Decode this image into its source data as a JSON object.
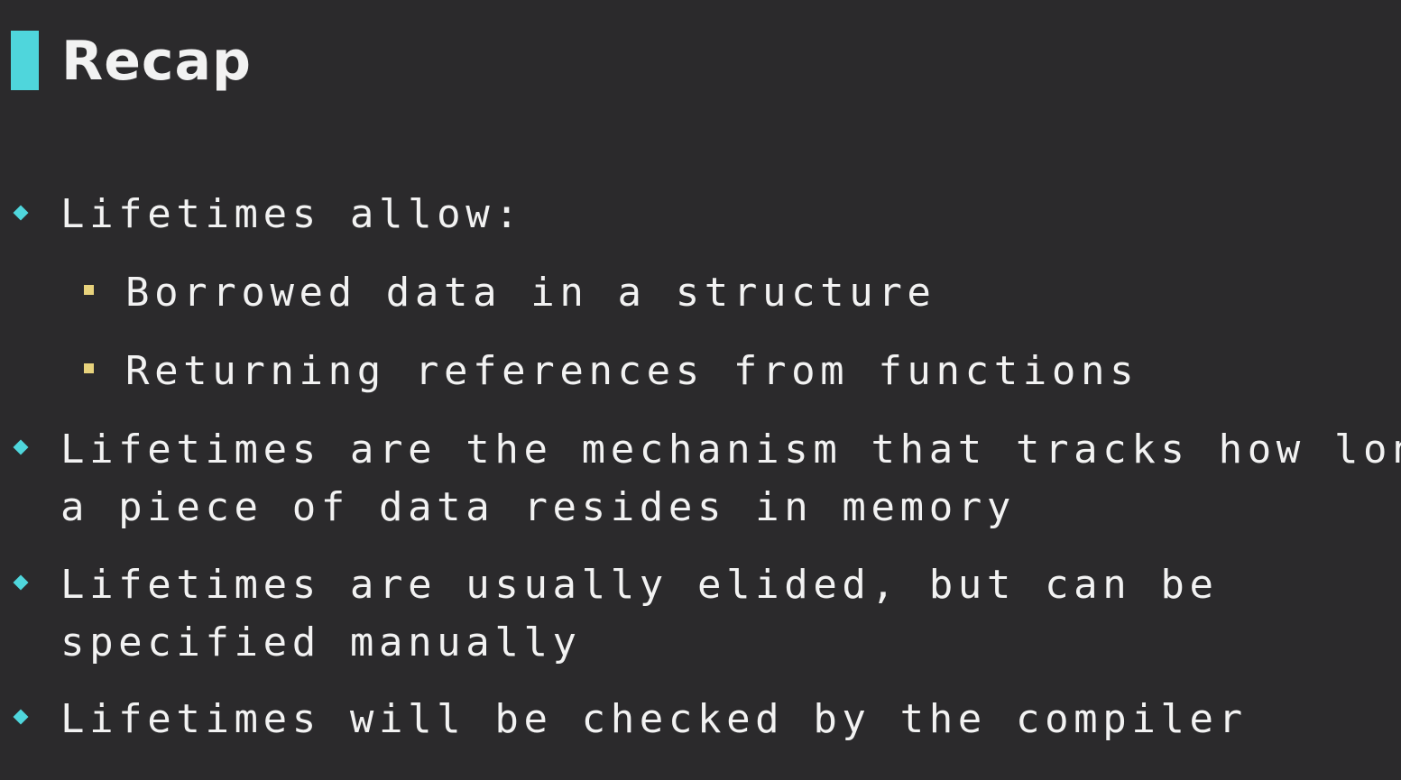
{
  "colors": {
    "background": "#2b2a2c",
    "accent": "#4fd6dc",
    "sub_bullet": "#e7d27c",
    "text": "#f2f2f2"
  },
  "slide": {
    "title": "Recap",
    "bullets": [
      {
        "lines": [
          "Lifetimes allow:"
        ]
      },
      {
        "lines": [
          "Borrowed data in a structure"
        ],
        "level": 2
      },
      {
        "lines": [
          "Returning references from functions"
        ],
        "level": 2
      },
      {
        "lines": [
          "Lifetimes are the mechanism that tracks how long",
          "a piece of data resides in memory"
        ]
      },
      {
        "lines": [
          "Lifetimes are usually elided, but can be",
          "specified manually"
        ]
      },
      {
        "lines": [
          "Lifetimes will be checked by the compiler"
        ]
      }
    ]
  }
}
